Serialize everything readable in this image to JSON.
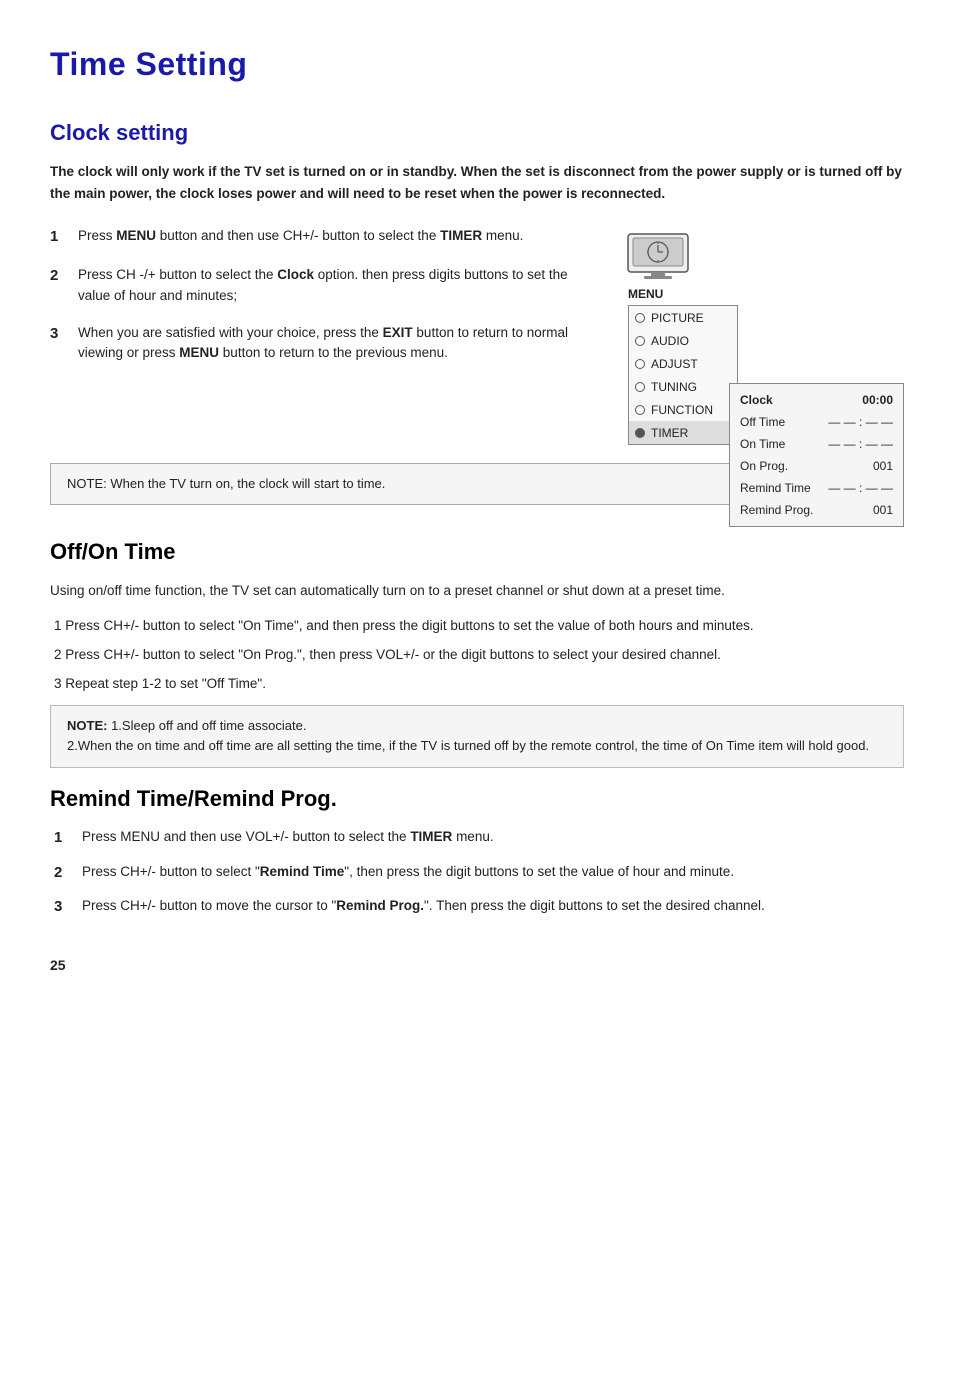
{
  "page": {
    "title": "Time Setting",
    "page_number": "25"
  },
  "clock_section": {
    "heading": "Clock setting",
    "intro": "The clock will only work if the TV set is  turned on or in standby. When the set is disconnect from the power supply or is turned off by the main power, the clock loses power and will need to be reset when the power is reconnected.",
    "steps": [
      {
        "num": "1",
        "text": "Press MENU button and then use CH+/- button to select the TIMER menu."
      },
      {
        "num": "2",
        "text": "Press CH -/+ button to select the Clock option. then press digits buttons to set the value of hour and minutes;"
      },
      {
        "num": "3",
        "text": "When you are satisfied with your choice, press the EXIT button to return to normal viewing or press MENU button to return to the previous menu."
      }
    ],
    "note": "NOTE: When the TV turn on, the clock will start to time.",
    "menu_label": "MENU",
    "menu_items": [
      {
        "label": "PICTURE",
        "circle": "empty",
        "highlighted": false
      },
      {
        "label": "AUDIO",
        "circle": "empty",
        "highlighted": false
      },
      {
        "label": "ADJUST",
        "circle": "empty",
        "highlighted": false
      },
      {
        "label": "TUNING",
        "circle": "empty",
        "highlighted": false
      },
      {
        "label": "FUNCTION",
        "circle": "empty",
        "highlighted": false
      },
      {
        "label": "TIMER",
        "circle": "filled",
        "highlighted": true
      }
    ],
    "submenu_items": [
      {
        "label": "Clock",
        "value": "00:00",
        "selected": true
      },
      {
        "label": "Off Time",
        "value": "— — : — —",
        "selected": false
      },
      {
        "label": "On Time",
        "value": "— — : — —",
        "selected": false
      },
      {
        "label": "On Prog.",
        "value": "001",
        "selected": false
      },
      {
        "label": "Remind Time",
        "value": "— — : — —",
        "selected": false
      },
      {
        "label": "Remind Prog.",
        "value": "001",
        "selected": false
      }
    ]
  },
  "offontime_section": {
    "heading": "Off/On Time",
    "intro": "Using on/off time function, the TV set can automatically turn on to a preset channel or shut down at a preset time.",
    "steps": [
      {
        "num": "1",
        "text": "Press CH+/- button to select  \"On Time\", and then press the digit buttons to set the value of both hours and minutes."
      },
      {
        "num": "2",
        "text": "Press CH+/- button to select  \"On Prog.\", then press VOL+/- or the digit buttons to select your desired channel."
      },
      {
        "num": "3",
        "text": "Repeat step 1-2 to set \"Off Time\"."
      }
    ],
    "note_title": "NOTE:",
    "note_lines": [
      "1.Sleep off and off time associate.",
      "2.When the on time and off time are all setting the time, if the TV is turned off by the remote control, the time of On Time item will hold good."
    ]
  },
  "remind_section": {
    "heading": "Remind Time/Remind Prog.",
    "steps": [
      {
        "num": "1",
        "text": "Press MENU and then use VOL+/- button to select the TIMER menu."
      },
      {
        "num": "2",
        "text": "Press CH+/- button to select  \"Remind Time\", then press the digit buttons to set the value of hour and minute."
      },
      {
        "num": "3",
        "text": "Press CH+/- button to move the cursor to \"Remind Prog.\". Then press the digit buttons to set the desired channel."
      }
    ]
  }
}
